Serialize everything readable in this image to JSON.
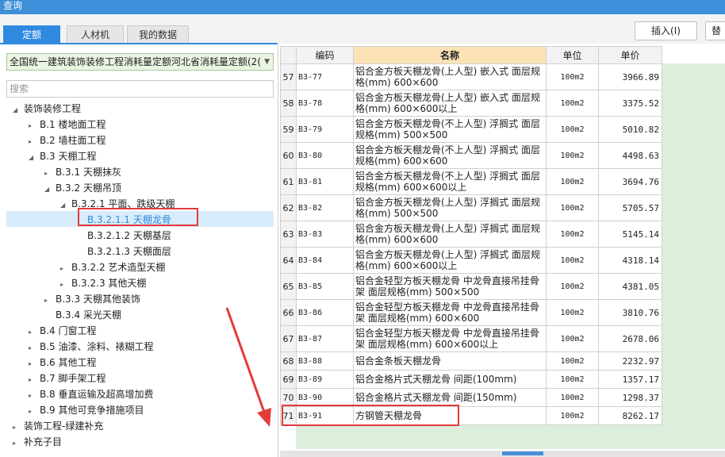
{
  "window": {
    "title": "查询"
  },
  "tabs": [
    {
      "label": "定额",
      "active": true
    },
    {
      "label": "人材机",
      "active": false
    },
    {
      "label": "我的数据",
      "active": false
    }
  ],
  "toolbar": {
    "insert_label": "插入(I)",
    "partial_label": "替"
  },
  "left": {
    "dropdown_value": "全国统一建筑装饰装修工程消耗量定额河北省消耗量定额(2(",
    "search_placeholder": "搜索",
    "tree": [
      {
        "label": "装饰装修工程",
        "level": 0,
        "toggle": "expanded"
      },
      {
        "label": "B.1 楼地面工程",
        "level": 1,
        "toggle": "collapsed"
      },
      {
        "label": "B.2 墙柱面工程",
        "level": 1,
        "toggle": "collapsed"
      },
      {
        "label": "B.3 天棚工程",
        "level": 1,
        "toggle": "expanded"
      },
      {
        "label": "B.3.1 天棚抹灰",
        "level": 2,
        "toggle": "collapsed"
      },
      {
        "label": "B.3.2 天棚吊顶",
        "level": 2,
        "toggle": "expanded"
      },
      {
        "label": "B.3.2.1 平面、跌级天棚",
        "level": 3,
        "toggle": "expanded"
      },
      {
        "label": "B.3.2.1.1 天棚龙骨",
        "level": 4,
        "toggle": "none",
        "selected": true
      },
      {
        "label": "B.3.2.1.2 天棚基层",
        "level": 4,
        "toggle": "none"
      },
      {
        "label": "B.3.2.1.3 天棚面层",
        "level": 4,
        "toggle": "none"
      },
      {
        "label": "B.3.2.2 艺术造型天棚",
        "level": 3,
        "toggle": "collapsed"
      },
      {
        "label": "B.3.2.3 其他天棚",
        "level": 3,
        "toggle": "collapsed"
      },
      {
        "label": "B.3.3 天棚其他装饰",
        "level": 2,
        "toggle": "collapsed"
      },
      {
        "label": "B.3.4 采光天棚",
        "level": 2,
        "toggle": "none"
      },
      {
        "label": "B.4 门窗工程",
        "level": 1,
        "toggle": "collapsed"
      },
      {
        "label": "B.5 油漆、涂料、裱糊工程",
        "level": 1,
        "toggle": "collapsed"
      },
      {
        "label": "B.6 其他工程",
        "level": 1,
        "toggle": "collapsed"
      },
      {
        "label": "B.7 脚手架工程",
        "level": 1,
        "toggle": "collapsed"
      },
      {
        "label": "B.8 垂直运输及超高增加费",
        "level": 1,
        "toggle": "collapsed"
      },
      {
        "label": "B.9 其他可竞争措施项目",
        "level": 1,
        "toggle": "collapsed"
      },
      {
        "label": "装饰工程-绿建补充",
        "level": 0,
        "toggle": "collapsed"
      },
      {
        "label": "补充子目",
        "level": 0,
        "toggle": "collapsed"
      }
    ]
  },
  "grid": {
    "columns": [
      "",
      "编码",
      "名称",
      "单位",
      "单价"
    ],
    "rows": [
      {
        "idx": "57",
        "code": "B3-77",
        "name": "铝合金方板天棚龙骨(上人型) 嵌入式 面层规格(mm) 600×600",
        "unit": "100m2",
        "price": "3966.89"
      },
      {
        "idx": "58",
        "code": "B3-78",
        "name": "铝合金方板天棚龙骨(上人型) 嵌入式 面层规格(mm) 600×600以上",
        "unit": "100m2",
        "price": "3375.52"
      },
      {
        "idx": "59",
        "code": "B3-79",
        "name": "铝合金方板天棚龙骨(不上人型) 浮搁式 面层规格(mm) 500×500",
        "unit": "100m2",
        "price": "5010.82"
      },
      {
        "idx": "60",
        "code": "B3-80",
        "name": "铝合金方板天棚龙骨(不上人型) 浮搁式 面层规格(mm) 600×600",
        "unit": "100m2",
        "price": "4498.63"
      },
      {
        "idx": "61",
        "code": "B3-81",
        "name": "铝合金方板天棚龙骨(不上人型) 浮搁式 面层规格(mm) 600×600以上",
        "unit": "100m2",
        "price": "3694.76"
      },
      {
        "idx": "62",
        "code": "B3-82",
        "name": "铝合金方板天棚龙骨(上人型) 浮搁式 面层规格(mm) 500×500",
        "unit": "100m2",
        "price": "5705.57"
      },
      {
        "idx": "63",
        "code": "B3-83",
        "name": "铝合金方板天棚龙骨(上人型) 浮搁式 面层规格(mm) 600×600",
        "unit": "100m2",
        "price": "5145.14"
      },
      {
        "idx": "64",
        "code": "B3-84",
        "name": "铝合金方板天棚龙骨(上人型) 浮搁式 面层规格(mm) 600×600以上",
        "unit": "100m2",
        "price": "4318.14"
      },
      {
        "idx": "65",
        "code": "B3-85",
        "name": "铝合金轻型方板天棚龙骨 中龙骨直接吊挂骨架 面层规格(mm) 500×500",
        "unit": "100m2",
        "price": "4381.05"
      },
      {
        "idx": "66",
        "code": "B3-86",
        "name": "铝合金轻型方板天棚龙骨 中龙骨直接吊挂骨架 面层规格(mm) 600×600",
        "unit": "100m2",
        "price": "3810.76"
      },
      {
        "idx": "67",
        "code": "B3-87",
        "name": "铝合金轻型方板天棚龙骨 中龙骨直接吊挂骨架 面层规格(mm) 600×600以上",
        "unit": "100m2",
        "price": "2678.06"
      },
      {
        "idx": "68",
        "code": "B3-88",
        "name": "铝合金条板天棚龙骨",
        "unit": "100m2",
        "price": "2232.97"
      },
      {
        "idx": "69",
        "code": "B3-89",
        "name": "铝合金格片式天棚龙骨 间距(100mm)",
        "unit": "100m2",
        "price": "1357.17"
      },
      {
        "idx": "70",
        "code": "B3-90",
        "name": "铝合金格片式天棚龙骨 间距(150mm)",
        "unit": "100m2",
        "price": "1298.37"
      },
      {
        "idx": "71",
        "code": "B3-91",
        "name": "方钢管天棚龙骨",
        "unit": "100m2",
        "price": "8262.17"
      }
    ]
  },
  "colors": {
    "accent": "#2f8ae0",
    "annotation": "#e23b3b",
    "name_header": "#fbe3b6",
    "empty_area": "#dcefdc"
  }
}
